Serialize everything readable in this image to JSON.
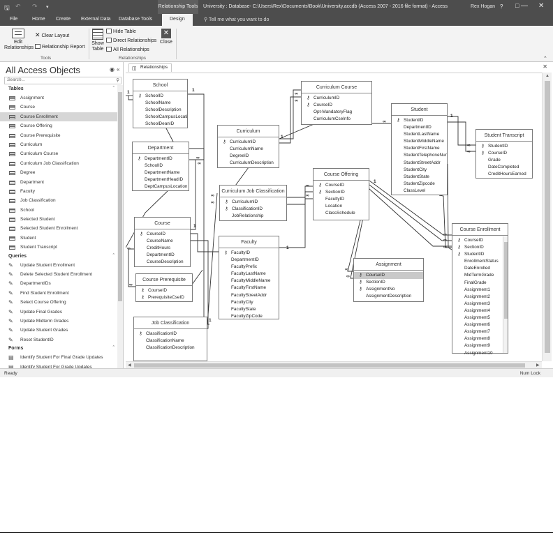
{
  "titlebar": {
    "context_tab": "Relationship Tools",
    "window_title": "University : Database- C:\\Users\\Rex\\Documents\\Book\\University.accdb (Access 2007 - 2016 file format) - Access",
    "user": "Rex Hogan",
    "help": "?",
    "minimize": "—",
    "restore": "☐",
    "close": "✕"
  },
  "ribbon_tabs": [
    "File",
    "Home",
    "Create",
    "External Data",
    "Database Tools",
    "Design"
  ],
  "active_tab": "Design",
  "tell_me": "Tell me what you want to do",
  "ribbon": {
    "edit_relationships": "Edit Relationships",
    "clear_layout": "Clear Layout",
    "relationship_report": "Relationship Report",
    "tools_group": "Tools",
    "show_table": "Show Table",
    "hide_table": "Hide Table",
    "direct_relationships": "Direct Relationships",
    "all_relationships": "All Relationships",
    "close": "Close",
    "relationships_group": "Relationships"
  },
  "nav": {
    "title": "All Access Objects",
    "search_placeholder": "Search...",
    "sections": {
      "tables": "Tables",
      "queries": "Queries",
      "forms": "Forms"
    },
    "tables": [
      "Assignment",
      "Course",
      "Course Enrollment",
      "Course Offering",
      "Course Prerequisite",
      "Curriculum",
      "Curriculum Course",
      "Curriculum Job Classification",
      "Degree",
      "Department",
      "Faculty",
      "Job Classification",
      "School",
      "Selected Student",
      "Selected Student Enrollment",
      "Student",
      "Student Transcript"
    ],
    "selected_table": "Course Enrollment",
    "queries": [
      "Update Student Enrollment",
      "Delete Selected Student Enrollment",
      "DepartmentIDs",
      "Find Student Enrollment",
      "Select Course Offering",
      "Update Final Grades",
      "Update Midterm Grades",
      "Update Student Grades",
      "Reset StudentID"
    ],
    "forms": [
      "Identify Student For Final Grade Updates",
      "Identify Student For Grade Updates"
    ]
  },
  "document_tab": "Relationships",
  "tables": {
    "school": {
      "name": "School",
      "fields": [
        "SchoolID",
        "SchoolName",
        "SchoolDescription",
        "SchoolCampusLocation",
        "SchoolDeanID"
      ],
      "keys": [
        0
      ]
    },
    "department": {
      "name": "Department",
      "fields": [
        "DepartmentID",
        "SchoolID",
        "DepartmentName",
        "DepartmentHeadID",
        "DeptCampusLocation"
      ],
      "keys": [
        0
      ]
    },
    "course": {
      "name": "Course",
      "fields": [
        "CourseID",
        "CourseName",
        "CreditHours",
        "DepartmentID",
        "CourseDescription"
      ],
      "keys": [
        0
      ]
    },
    "course_prerequisite": {
      "name": "Course Prerequisite",
      "fields": [
        "CourseID",
        "PrerequisiteCseID"
      ],
      "keys": [
        0,
        1
      ]
    },
    "job_classification": {
      "name": "Job Classification",
      "fields": [
        "ClassificationID",
        "ClassificationName",
        "ClassificationDescription"
      ],
      "keys": [
        0
      ]
    },
    "curriculum": {
      "name": "Curriculum",
      "fields": [
        "CurriculumID",
        "CurriculumName",
        "DegreeID",
        "CurriculumDescription"
      ],
      "keys": [
        0
      ]
    },
    "curriculum_course": {
      "name": "Curriculum Course",
      "fields": [
        "CurriculumID",
        "CourseID",
        "Opt-MandatoryFlag",
        "CurriculumCseInfo"
      ],
      "keys": [
        0,
        1
      ]
    },
    "curriculum_job_classification": {
      "name": "Curriculum Job Classification",
      "fields": [
        "CurriculumID",
        "ClassificationID",
        "JobRelationship"
      ],
      "keys": [
        0,
        1
      ]
    },
    "faculty": {
      "name": "Faculty",
      "fields": [
        "FacultyID",
        "DepartmentID",
        "FacultyPrefix",
        "FacultyLastName",
        "FacultyMiddleName",
        "FacultyFirstName",
        "FacultyStreetAddr",
        "FacultyCity",
        "FacultyState",
        "FacultyZipCode"
      ],
      "keys": [
        0
      ]
    },
    "course_offering": {
      "name": "Course Offering",
      "fields": [
        "CourseID",
        "SectionID",
        "FacultyID",
        "Location",
        "ClassSchedule"
      ],
      "keys": [
        0,
        1
      ]
    },
    "assignment": {
      "name": "Assignment",
      "fields": [
        "CourseID",
        "SectionID",
        "AssignmentNo",
        "AssignmentDescription"
      ],
      "keys": [
        0,
        1,
        2
      ]
    },
    "student": {
      "name": "Student",
      "fields": [
        "StudentID",
        "DepartmentID",
        "StudentLastName",
        "StudentMiddleName",
        "StudentFirstName",
        "StudentTelephoneNumber",
        "StudentStreetAddr",
        "StudentCity",
        "StudentState",
        "StudentZipcode",
        "ClassLevel"
      ],
      "keys": [
        0
      ]
    },
    "student_transcript": {
      "name": "Student Transcript",
      "fields": [
        "StudentID",
        "CourseID",
        "Grade",
        "DateCompleted",
        "CreditHoursEarned"
      ],
      "keys": [
        0,
        1
      ]
    },
    "course_enrollment": {
      "name": "Course Enrollment",
      "fields": [
        "CourseID",
        "SectionID",
        "StudentID",
        "EnrollmentStatus",
        "DateEnrolled",
        "MidTermGrade",
        "FinalGrade",
        "Assignment1",
        "Assignment2",
        "Assignment3",
        "Assignment4",
        "Assignment5",
        "Assignment6",
        "Assignment7",
        "Assignment8",
        "Assignment9",
        "Assignment10"
      ],
      "keys": [
        0,
        1,
        2
      ]
    }
  },
  "rel_one": "1",
  "rel_many": "∞",
  "status": {
    "left": "Ready",
    "right": "Num Lock"
  }
}
